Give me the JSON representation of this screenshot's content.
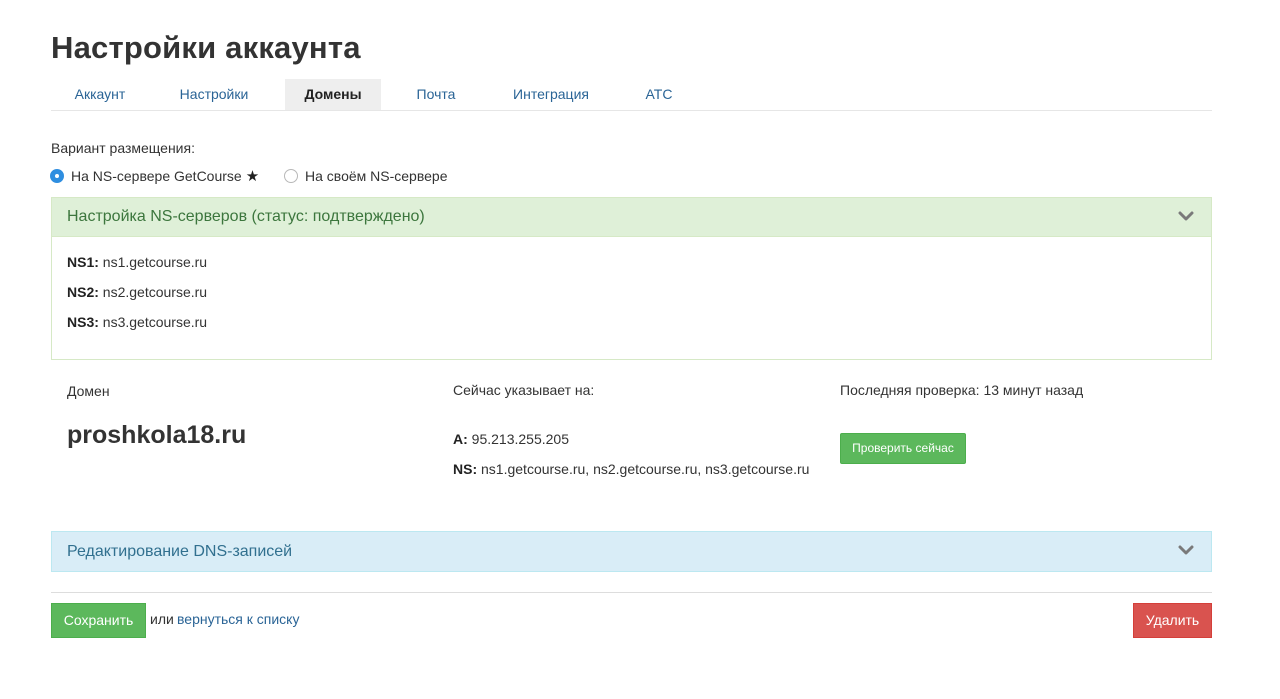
{
  "page": {
    "title": "Настройки аккаунта"
  },
  "tabs": [
    {
      "label": "Аккаунт",
      "active": false
    },
    {
      "label": "Настройки",
      "active": false
    },
    {
      "label": "Домены",
      "active": true
    },
    {
      "label": "Почта",
      "active": false
    },
    {
      "label": "Интеграция",
      "active": false
    },
    {
      "label": "АТС",
      "active": false
    }
  ],
  "placement": {
    "label": "Вариант размещения:",
    "options": [
      {
        "label": "На NS-сервере GetCourse",
        "checked": true,
        "star": "★"
      },
      {
        "label": "На своём NS-сервере",
        "checked": false
      }
    ]
  },
  "ns_panel": {
    "title": "Настройка NS-серверов (статус: подтверждено)",
    "rows": [
      {
        "key": "NS1:",
        "value": "ns1.getcourse.ru"
      },
      {
        "key": "NS2:",
        "value": "ns2.getcourse.ru"
      },
      {
        "key": "NS3:",
        "value": "ns3.getcourse.ru"
      }
    ]
  },
  "domain": {
    "label": "Домен",
    "name": "proshkola18.ru",
    "points_label": "Сейчас указывает на:",
    "a_key": "A:",
    "a_value": "95.213.255.205",
    "ns_key": "NS:",
    "ns_value": "ns1.getcourse.ru, ns2.getcourse.ru, ns3.getcourse.ru",
    "last_check": "Последняя проверка: 13 минут назад",
    "check_button": "Проверить сейчас"
  },
  "dns_panel": {
    "title": "Редактирование DNS-записей"
  },
  "footer": {
    "save": "Сохранить",
    "or": "или",
    "back": "вернуться к списку",
    "delete": "Удалить"
  },
  "colors": {
    "success": "#5cb85c",
    "danger": "#d9534f",
    "link": "#2a6496",
    "panel_success_bg": "#dff0d8",
    "panel_info_bg": "#d9edf7"
  },
  "icons": {
    "collapse": "chevron-down-icon",
    "selected_radio": "radio-checked-icon"
  }
}
